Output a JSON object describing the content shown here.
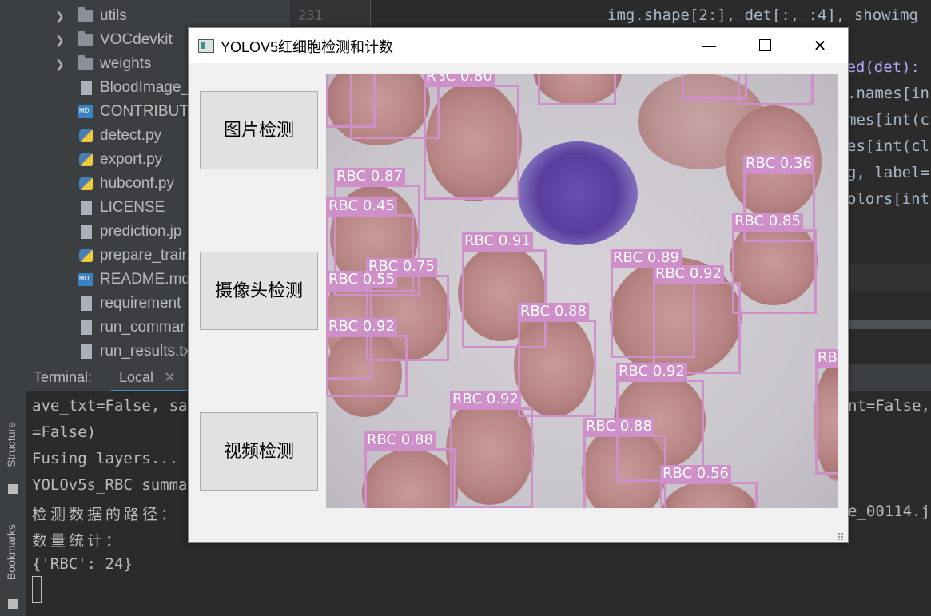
{
  "tool_strip": {
    "structure": "Structure",
    "bookmarks": "Bookmarks"
  },
  "tree": [
    {
      "type": "folder",
      "label": "utils"
    },
    {
      "type": "folder",
      "label": "VOCdevkit"
    },
    {
      "type": "folder",
      "label": "weights"
    },
    {
      "type": "file",
      "icon": "image-file-icon",
      "label": "BloodImage_"
    },
    {
      "type": "md",
      "icon": "markdown-file-icon",
      "label": "CONTRIBUTI"
    },
    {
      "type": "py",
      "icon": "python-file-icon",
      "label": "detect.py"
    },
    {
      "type": "py",
      "icon": "python-file-icon",
      "label": "export.py"
    },
    {
      "type": "py",
      "icon": "python-file-icon",
      "label": "hubconf.py"
    },
    {
      "type": "file",
      "icon": "text-file-icon",
      "label": "LICENSE"
    },
    {
      "type": "file",
      "icon": "image-file-icon",
      "label": "prediction.jp"
    },
    {
      "type": "py",
      "icon": "python-file-icon",
      "label": "prepare_trair"
    },
    {
      "type": "md",
      "icon": "markdown-file-icon",
      "label": "README.md"
    },
    {
      "type": "file",
      "icon": "text-file-icon",
      "label": "requirement"
    },
    {
      "type": "file",
      "icon": "text-file-icon",
      "label": "run_commar"
    },
    {
      "type": "file",
      "icon": "text-file-icon",
      "label": "run_results.tx"
    }
  ],
  "editor": {
    "line_number": "231",
    "lines": [
      "img.shape[2:], det[:, :4], showimg",
      "sed(det):",
      ".names[in",
      "mes[int(c",
      "es[int(cl",
      "g, label=",
      "olors[int"
    ]
  },
  "terminal": {
    "title": "Terminal:",
    "tab": "Local",
    "lines": [
      "ave_txt=False, sa",
      "=False)",
      "Fusing layers...",
      "YOLOv5s_RBC summa",
      "检测数据的路径：",
      "数量统计：",
      "{'RBC': 24}"
    ],
    "right_fragments": [
      "nt=False,",
      "e_00114.j"
    ]
  },
  "dialog": {
    "title": "YOLOV5红细胞检测和计数",
    "buttons": {
      "image": "图片检测",
      "camera": "摄像头检测",
      "video": "视频检测"
    },
    "window_controls": {
      "minimize": "—",
      "close": "✕"
    },
    "detections": [
      "RBC 0.80",
      "RBC 0.87",
      "RBC 0.45",
      "RBC 0.36",
      "RBC 0.85",
      "RBC 0.91",
      "RBC 0.89",
      "RBC 0.92",
      "RBC 0.75",
      "RBC 0.55",
      "RBC 0.88",
      "RBC 0.92",
      "RBC 0.92",
      "RBC 0.92",
      "RBC 0.88",
      "RBC 0.88",
      "RBC 0.56",
      "RB"
    ],
    "box_color": "#cf8fc9"
  }
}
